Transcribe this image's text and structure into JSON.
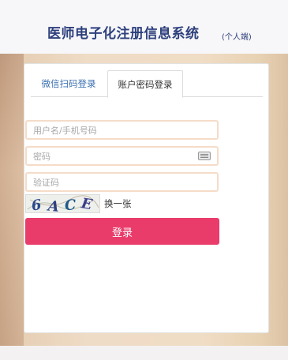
{
  "header": {
    "title": "医师电子化注册信息系统",
    "subtitle": "(个人端)"
  },
  "tabs": [
    {
      "label": "微信扫码登录",
      "active": false
    },
    {
      "label": "账户密码登录",
      "active": true
    }
  ],
  "form": {
    "username_placeholder": "用户名/手机号码",
    "password_placeholder": "密码",
    "captcha_placeholder": "验证码",
    "captcha_text": "6ACE",
    "refresh_label": "换一张",
    "login_label": "登录"
  },
  "icons": {
    "keyboard": "keyboard-icon"
  },
  "colors": {
    "title": "#2d3f7c",
    "login_button": "#e93c6b",
    "active_tab_text": "#333333",
    "inactive_tab_text": "#3a6fb0"
  }
}
